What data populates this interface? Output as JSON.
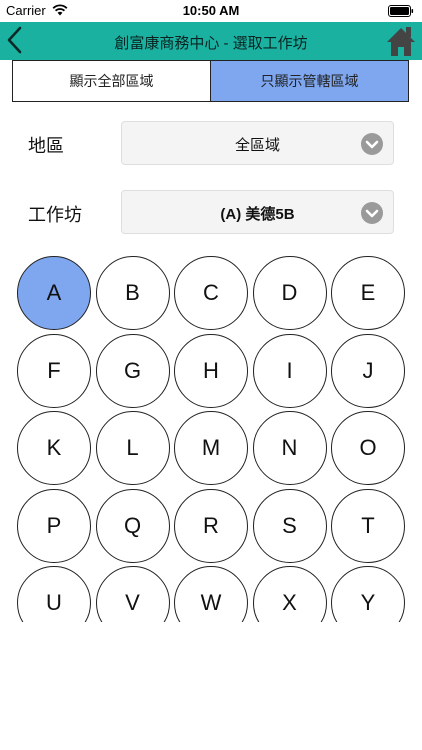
{
  "status_bar": {
    "carrier": "Carrier",
    "time": "10:50 AM"
  },
  "nav": {
    "title": "創富康商務中心 - 選取工作坊",
    "back_icon": "back-chevron-icon",
    "home_icon": "home-icon"
  },
  "segment": {
    "all_label": "顯示全部區域",
    "managed_label": "只顯示管轄區域",
    "selected": "managed"
  },
  "region": {
    "label": "地區",
    "value": "全區域"
  },
  "workshop": {
    "label": "工作坊",
    "value": "(A) 美德5B"
  },
  "letters": [
    "A",
    "B",
    "C",
    "D",
    "E",
    "F",
    "G",
    "H",
    "I",
    "J",
    "K",
    "L",
    "M",
    "N",
    "O",
    "P",
    "Q",
    "R",
    "S",
    "T",
    "U",
    "V",
    "W",
    "X",
    "Y"
  ],
  "selected_letter": "A",
  "colors": {
    "nav_bg": "#1bb1a1",
    "selected": "#7ea7f0"
  }
}
